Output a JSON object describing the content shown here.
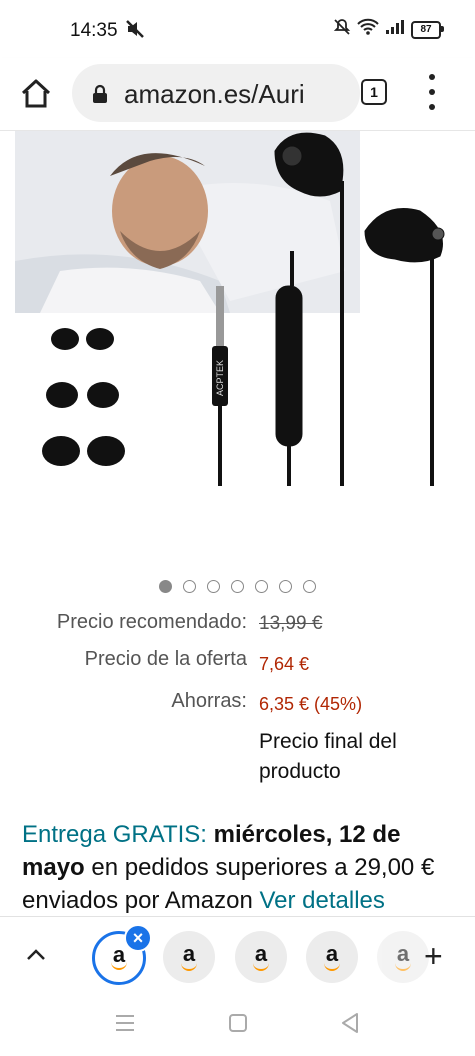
{
  "status_bar": {
    "time": "14:35",
    "battery": "87"
  },
  "browser": {
    "url": "amazon.es/Auri",
    "tab_count": "1"
  },
  "carousel": {
    "count": 7,
    "active_index": 0
  },
  "product_image": {
    "brand_on_plug": "ACPTEK"
  },
  "pricing": {
    "recommended_label": "Precio recomendado:",
    "recommended_value": "13,99 €",
    "offer_label": "Precio de la oferta",
    "offer_value": "7,64 €",
    "savings_label": "Ahorras:",
    "savings_value": "6,35 € (45%)",
    "final_note_line1": "Precio final del",
    "final_note_line2": "producto"
  },
  "delivery": {
    "prefix": "Entrega GRATIS:",
    "date": "miércoles, 12 de mayo",
    "middle": "en pedidos superiores a 29,00 € enviados por Amazon",
    "link": "Ver detalles"
  },
  "tab_strip": {
    "tabs": [
      "a",
      "a",
      "a",
      "a",
      "a"
    ],
    "close_symbol": "×",
    "add_symbol": "+"
  },
  "colors": {
    "price_red": "#b12704",
    "link_teal": "#007185",
    "active_tab_blue": "#1a73e8",
    "amazon_orange": "#ff9900"
  }
}
